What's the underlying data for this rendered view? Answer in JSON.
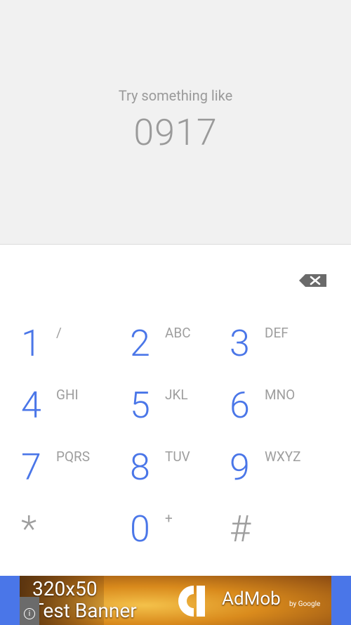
{
  "hint": {
    "prompt": "Try something like",
    "example_number": "0917"
  },
  "icons": {
    "backspace": "backspace-icon",
    "info": "info-icon",
    "admob_logo": "admob-logo-icon"
  },
  "keypad": {
    "keys": [
      {
        "digit": "1",
        "letters": "/"
      },
      {
        "digit": "2",
        "letters": "ABC"
      },
      {
        "digit": "3",
        "letters": "DEF"
      },
      {
        "digit": "4",
        "letters": "GHI"
      },
      {
        "digit": "5",
        "letters": "JKL"
      },
      {
        "digit": "6",
        "letters": "MNO"
      },
      {
        "digit": "7",
        "letters": "PQRS"
      },
      {
        "digit": "8",
        "letters": "TUV"
      },
      {
        "digit": "9",
        "letters": "WXYZ"
      },
      {
        "digit": "*",
        "letters": ""
      },
      {
        "digit": "0",
        "letters": "+"
      },
      {
        "digit": "#",
        "letters": ""
      }
    ]
  },
  "ad": {
    "line1": "320x50",
    "line2": "Test Banner",
    "brand": "AdMob",
    "by": "by Google",
    "info": "i"
  },
  "colors": {
    "accent": "#4a76e8",
    "hint_bg": "#f1f1f1",
    "muted_text": "#9a9a9a"
  }
}
